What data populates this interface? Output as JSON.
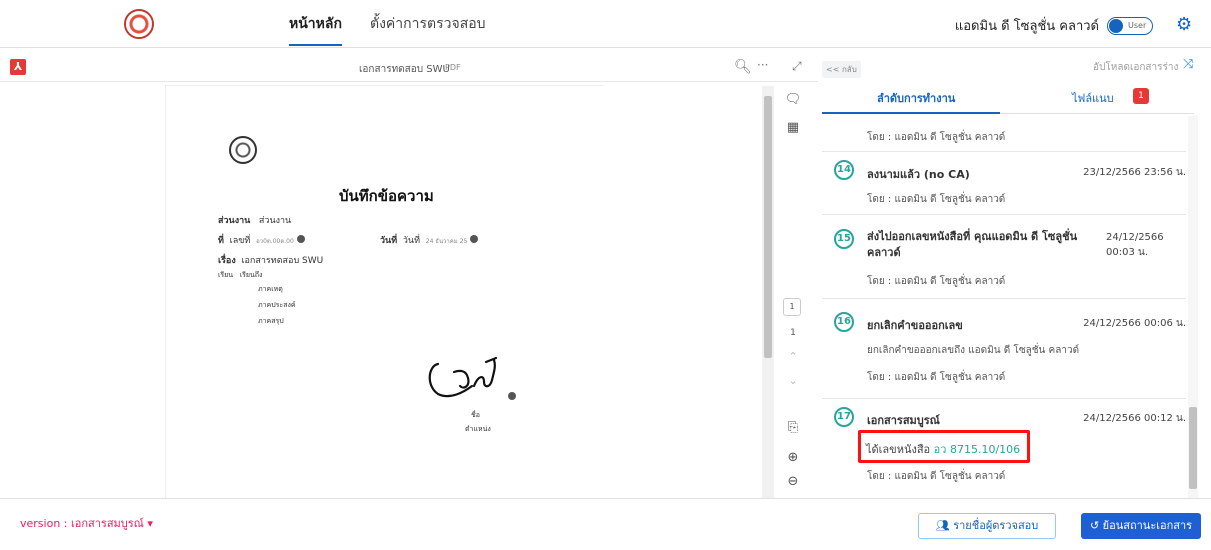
{
  "header": {
    "tabs": [
      {
        "label": "หน้าหลัก"
      },
      {
        "label": "ตั้งค่าการตรวจสอบ"
      }
    ],
    "user_name": "แอดมิน ดี โซลูชั่น คลาวด์",
    "toggle_label": "User"
  },
  "pdf_viewer": {
    "file_title": "เอกสารทดสอบ SWU",
    "file_ext": "PDF",
    "document": {
      "title": "บันทึกข้อความ",
      "division_label": "ส่วนงาน",
      "division_value": "ส่วนงาน",
      "number_label": "ที่",
      "number_value": "เลขที่",
      "number_sub": "อว0ต.00ต.00",
      "date_label": "วันที่",
      "date_value": "วันที่",
      "date_sub": "24 ธันวาคม 25",
      "subject_label": "เรื่อง",
      "subject_value": "เอกสารทดสอบ SWU",
      "to_label": "เรียน",
      "to_value": "เรียนถึง",
      "body_lines": [
        "ภาคเหตุ",
        "ภาคประสงค์",
        "ภาคสรุป"
      ],
      "sign_name": "ชื่อ",
      "sign_position": "ตำแหน่ง"
    },
    "page_number": "1",
    "page_total": "1"
  },
  "right_panel": {
    "back_label": "<< กลับ",
    "upload_label": "อัปโหลดเอกสารร่าง",
    "tab_steps": "ลำดับการทำงาน",
    "tab_files": "ไฟล์แนบ",
    "files_count": "1",
    "top_by": "โดย : แอดมิน ดี โซลูชั่น คลาวด์",
    "items": [
      {
        "num": "14",
        "title": "ลงนามแล้ว (no CA)",
        "date": "23/12/2566 23:56 น.",
        "by": "โดย : แอดมิน ดี โซลูชั่น คลาวด์"
      },
      {
        "num": "15",
        "title": "ส่งไปออกเลขหนังสือที่ คุณแอดมิน ดี โซลูชั่น คลาวด์",
        "date": "24/12/2566 00:03 น.",
        "by": "โดย : แอดมิน ดี โซลูชั่น คลาวด์"
      },
      {
        "num": "16",
        "title": "ยกเลิกคำขอออกเลข",
        "date": "24/12/2566 00:06 น.",
        "text": "ยกเลิกคำขอออกเลขถึง แอดมิน ดี โซลูชั่น คลาวด์",
        "by": "โดย : แอดมิน ดี โซลูชั่น คลาวด์"
      },
      {
        "num": "17",
        "title": "เอกสารสมบูรณ์",
        "date": "24/12/2566 00:12 น.",
        "text": "ได้เลขหนังสือ",
        "doc_number": "อว 8715.10/106",
        "by": "โดย : แอดมิน ดี โซลูชั่น คลาวด์"
      }
    ]
  },
  "footer": {
    "version_label": "version : เอกสารสมบูรณ์",
    "reviewers_button": "รายชื่อผู้ตรวจสอบ",
    "revert_button": "ย้อนสถานะเอกสาร"
  },
  "colors": {
    "primary": "#1565c0",
    "accent": "#26a69a",
    "highlight": "#ff1111",
    "version": "#e91e63"
  }
}
